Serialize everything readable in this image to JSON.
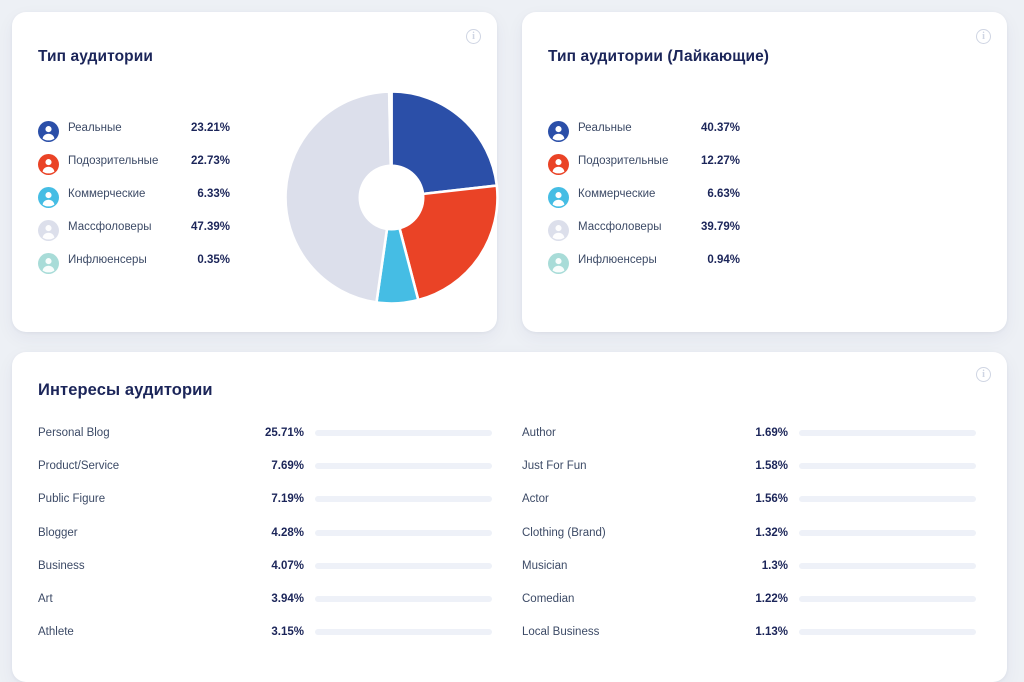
{
  "colors": {
    "page_background": "#edf0f5",
    "card_background": "#ffffff",
    "title": "#1b2559",
    "label": "#3c4a66",
    "bar_fill": "#2a4fa8",
    "bar_track": "#eef1f8",
    "real": "#2b4fa8",
    "suspicious": "#ea4326",
    "commercial": "#45bde4",
    "massfollowers": "#dcdfeb",
    "influencers": "#a8dcd8"
  },
  "cards": {
    "audience_type": {
      "title": "Тип аудитории",
      "info_icon": "info-icon",
      "info_glyph": "i",
      "legend": [
        {
          "icon": "person-avatar-icon",
          "label": "Реальные",
          "value": "23.21%",
          "pct": 23.21,
          "color": "#2b4fa8"
        },
        {
          "icon": "person-avatar-icon",
          "label": "Подозрительные",
          "value": "22.73%",
          "pct": 22.73,
          "color": "#ea4326"
        },
        {
          "icon": "person-avatar-icon",
          "label": "Коммерческие",
          "value": "6.33%",
          "pct": 6.33,
          "color": "#45bde4"
        },
        {
          "icon": "person-avatar-icon",
          "label": "Массфоловеры",
          "value": "47.39%",
          "pct": 47.39,
          "color": "#dcdfeb"
        },
        {
          "icon": "person-avatar-icon",
          "label": "Инфлюенсеры",
          "value": "0.35%",
          "pct": 0.35,
          "color": "#a8dcd8"
        }
      ]
    },
    "audience_type_likes": {
      "title": "Тип аудитории (Лайкающие)",
      "info_icon": "info-icon",
      "info_glyph": "i",
      "legend": [
        {
          "icon": "person-avatar-icon",
          "label": "Реальные",
          "value": "40.37%",
          "pct": 40.37,
          "color": "#2b4fa8"
        },
        {
          "icon": "person-avatar-icon",
          "label": "Подозрительные",
          "value": "12.27%",
          "pct": 12.27,
          "color": "#ea4326"
        },
        {
          "icon": "person-avatar-icon",
          "label": "Коммерческие",
          "value": "6.63%",
          "pct": 6.63,
          "color": "#45bde4"
        },
        {
          "icon": "person-avatar-icon",
          "label": "Массфоловеры",
          "value": "39.79%",
          "pct": 39.79,
          "color": "#dcdfeb"
        },
        {
          "icon": "person-avatar-icon",
          "label": "Инфлюенсеры",
          "value": "0.94%",
          "pct": 0.94,
          "color": "#a8dcd8"
        }
      ]
    },
    "audience_interests": {
      "title": "Интересы аудитории",
      "info_icon": "info-icon",
      "info_glyph": "i",
      "left_column": [
        {
          "name": "Personal Blog",
          "value": "25.71%",
          "pct": 25.71
        },
        {
          "name": "Product/Service",
          "value": "7.69%",
          "pct": 7.69
        },
        {
          "name": "Public Figure",
          "value": "7.19%",
          "pct": 7.19
        },
        {
          "name": "Blogger",
          "value": "4.28%",
          "pct": 4.28
        },
        {
          "name": "Business",
          "value": "4.07%",
          "pct": 4.07
        },
        {
          "name": "Art",
          "value": "3.94%",
          "pct": 3.94
        },
        {
          "name": "Athlete",
          "value": "3.15%",
          "pct": 3.15
        }
      ],
      "right_column": [
        {
          "name": "Author",
          "value": "1.69%",
          "pct": 1.69
        },
        {
          "name": "Just For Fun",
          "value": "1.58%",
          "pct": 1.58
        },
        {
          "name": "Actor",
          "value": "1.56%",
          "pct": 1.56
        },
        {
          "name": "Clothing (Brand)",
          "value": "1.32%",
          "pct": 1.32
        },
        {
          "name": "Musician",
          "value": "1.3%",
          "pct": 1.3
        },
        {
          "name": "Comedian",
          "value": "1.22%",
          "pct": 1.22
        },
        {
          "name": "Local Business",
          "value": "1.13%",
          "pct": 1.13
        }
      ]
    }
  },
  "chart_data": [
    {
      "type": "pie",
      "title": "Тип аудитории",
      "categories": [
        "Реальные",
        "Подозрительные",
        "Коммерческие",
        "Массфоловеры",
        "Инфлюенсеры"
      ],
      "values": [
        23.21,
        22.73,
        6.33,
        47.39,
        0.35
      ],
      "colors": [
        "#2b4fa8",
        "#ea4326",
        "#45bde4",
        "#dcdfeb",
        "#a8dcd8"
      ],
      "unit": "%",
      "legend_position": "left",
      "donut": true,
      "start_angle_deg": 0
    },
    {
      "type": "pie",
      "title": "Тип аудитории (Лайкающие)",
      "categories": [
        "Реальные",
        "Подозрительные",
        "Коммерческие",
        "Массфоловеры",
        "Инфлюенсеры"
      ],
      "values": [
        40.37,
        12.27,
        6.63,
        39.79,
        0.94
      ],
      "colors": [
        "#2b4fa8",
        "#ea4326",
        "#45bde4",
        "#dcdfeb",
        "#a8dcd8"
      ],
      "unit": "%",
      "legend_position": "left",
      "donut": true,
      "start_angle_deg": 0
    },
    {
      "type": "bar",
      "title": "Интересы аудитории",
      "orientation": "horizontal",
      "categories": [
        "Personal Blog",
        "Product/Service",
        "Public Figure",
        "Blogger",
        "Business",
        "Art",
        "Athlete",
        "Author",
        "Just For Fun",
        "Actor",
        "Clothing (Brand)",
        "Musician",
        "Comedian",
        "Local Business"
      ],
      "values": [
        25.71,
        7.69,
        7.19,
        4.28,
        4.07,
        3.94,
        3.15,
        1.69,
        1.58,
        1.56,
        1.32,
        1.3,
        1.22,
        1.13
      ],
      "unit": "%",
      "xlim": [
        0,
        100
      ],
      "grid": false,
      "bar_color": "#2a4fa8",
      "track_color": "#eef1f8"
    }
  ]
}
